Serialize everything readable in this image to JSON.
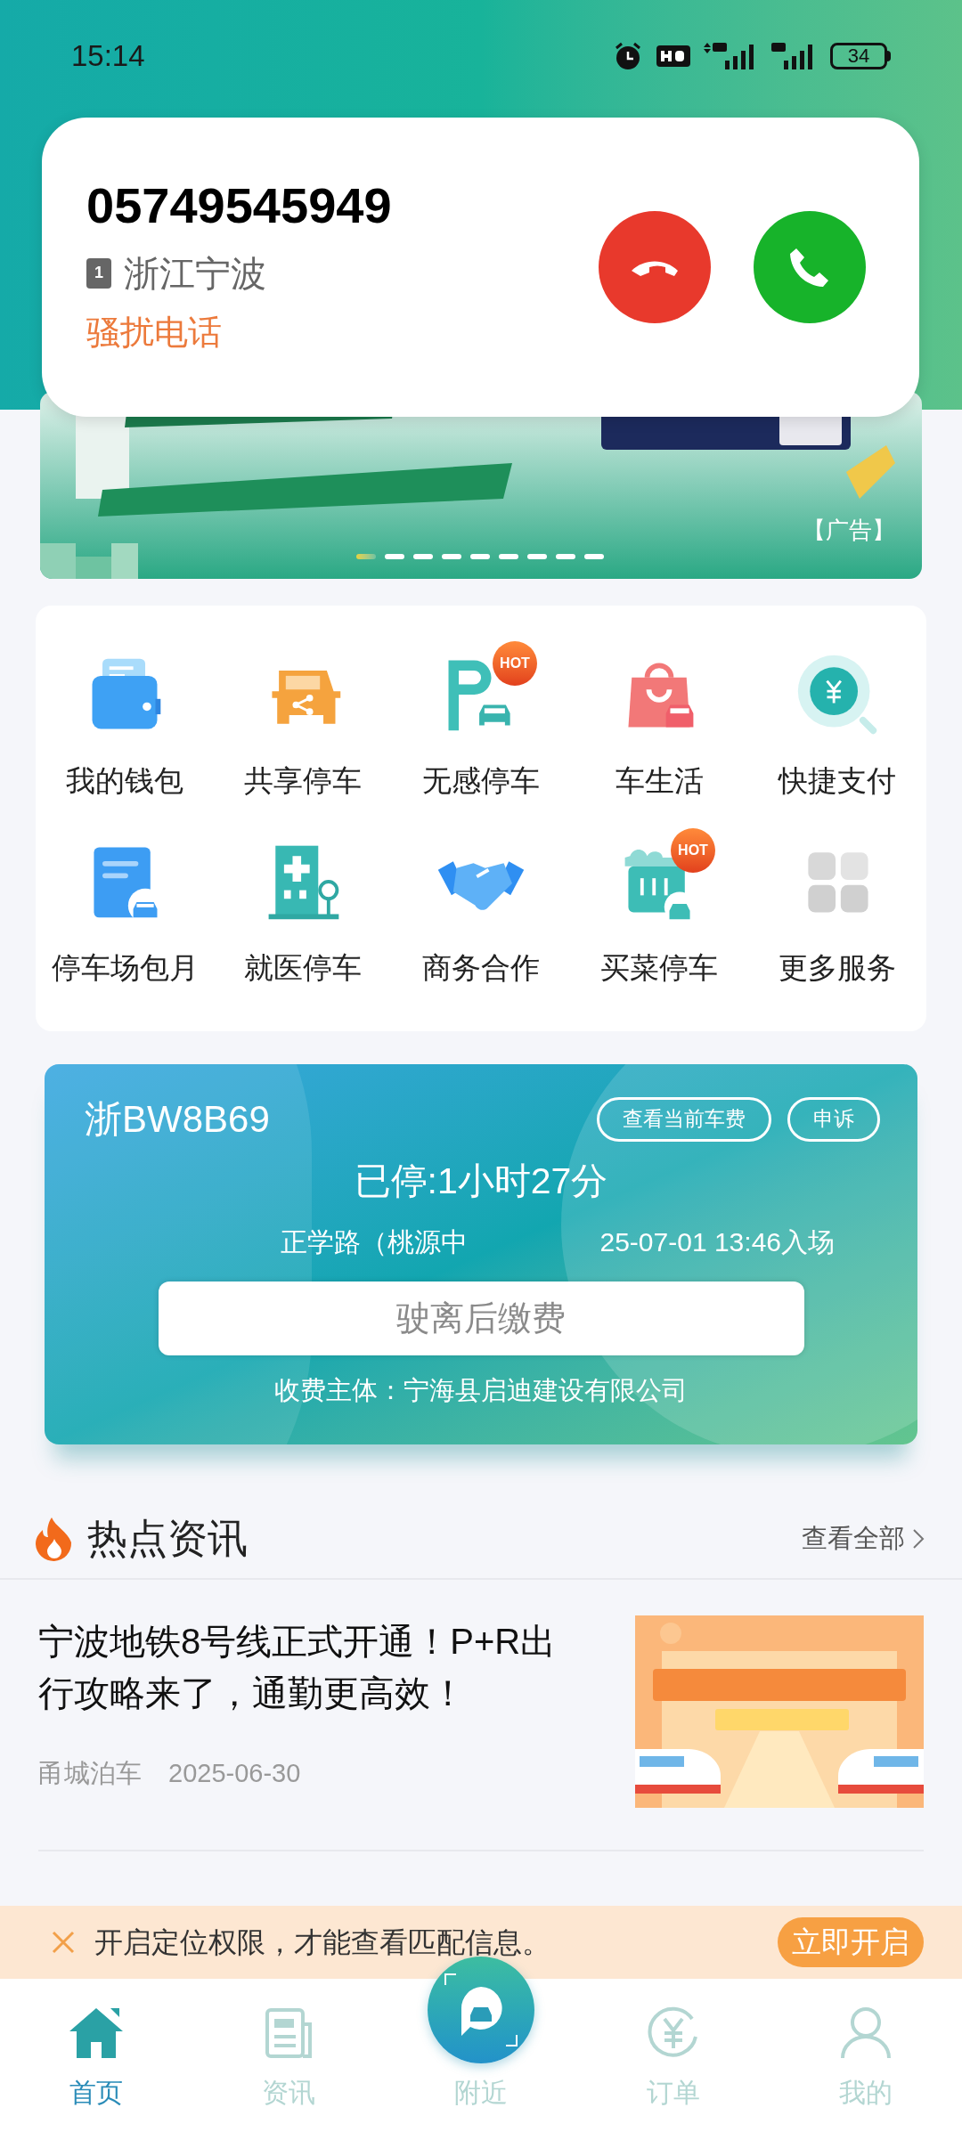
{
  "status_bar": {
    "time": "15:14",
    "battery": "34"
  },
  "incoming_call": {
    "number": "05749545949",
    "sim": "1",
    "location": "浙江宁波",
    "tag": "骚扰电话"
  },
  "banner": {
    "ad_label": "【广告】",
    "pages": [
      {
        "selected": true
      },
      {
        "selected": false
      },
      {
        "selected": false
      },
      {
        "selected": false
      },
      {
        "selected": false
      },
      {
        "selected": false
      },
      {
        "selected": false
      },
      {
        "selected": false
      },
      {
        "selected": false
      }
    ]
  },
  "services": [
    {
      "label": "我的钱包"
    },
    {
      "label": "共享停车"
    },
    {
      "label": "无感停车",
      "badge": "HOT"
    },
    {
      "label": "车生活"
    },
    {
      "label": "快捷支付"
    },
    {
      "label": "停车场包月"
    },
    {
      "label": "就医停车"
    },
    {
      "label": "商务合作"
    },
    {
      "label": "买菜停车",
      "badge": "HOT"
    },
    {
      "label": "更多服务"
    }
  ],
  "parking_card": {
    "plate": "浙BW8B69",
    "actions": [
      "查看当前车费",
      "申诉"
    ],
    "duration": "已停:1小时27分",
    "location": "正学路（桃源中",
    "entry_time": "25-07-01 13:46入场",
    "pay_button": "驶离后缴费",
    "payee": "收费主体：宁海县启迪建设有限公司"
  },
  "news": {
    "title": "热点资讯",
    "view_all": "查看全部",
    "items": [
      {
        "title": "宁波地铁8号线正式开通！P+R出行攻略来了，通勤更高效！",
        "source": "甬城泊车",
        "date": "2025-06-30"
      }
    ]
  },
  "location_prompt": {
    "text": "开启定位权限，才能查看匹配信息。",
    "button": "立即开启"
  },
  "nav": [
    {
      "label": "首页",
      "selected": true,
      "kind": "tab"
    },
    {
      "label": "资讯",
      "selected": false,
      "kind": "tab"
    },
    {
      "label": "附近",
      "selected": false,
      "kind": "center"
    },
    {
      "label": "订单",
      "selected": false,
      "kind": "tab"
    },
    {
      "label": "我的",
      "selected": false,
      "kind": "tab"
    }
  ]
}
